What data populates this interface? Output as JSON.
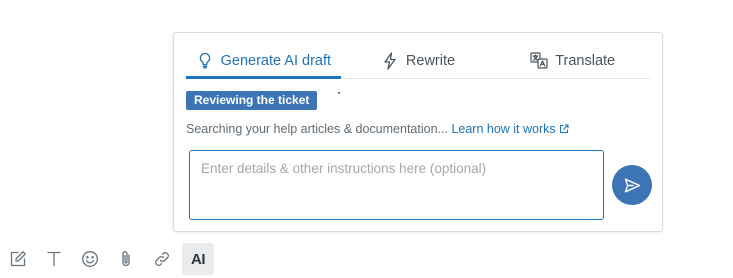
{
  "tabs": [
    {
      "label": "Generate AI draft",
      "icon": "lightbulb-icon",
      "active": true
    },
    {
      "label": "Rewrite",
      "icon": "lightning-icon",
      "active": false
    },
    {
      "label": "Translate",
      "icon": "translate-icon",
      "active": false
    }
  ],
  "status": {
    "badge": "Reviewing the ticket",
    "message": "Searching your help articles & documentation...",
    "link_label": "Learn how it works"
  },
  "input": {
    "placeholder": "Enter details & other instructions here (optional)",
    "value": ""
  },
  "send": {
    "icon": "send-icon"
  },
  "toolbar": {
    "items": [
      {
        "name": "compose-icon",
        "active": false
      },
      {
        "name": "text-format-icon",
        "active": false
      },
      {
        "name": "emoji-icon",
        "active": false
      },
      {
        "name": "attachment-icon",
        "active": false
      },
      {
        "name": "link-icon",
        "active": false
      },
      {
        "name": "ai-icon",
        "label": "AI",
        "active": true
      }
    ]
  },
  "colors": {
    "accent": "#1f73b7",
    "badge_bg": "#3c74b5",
    "text_muted": "#5f6b73",
    "border": "#d8dcde"
  }
}
